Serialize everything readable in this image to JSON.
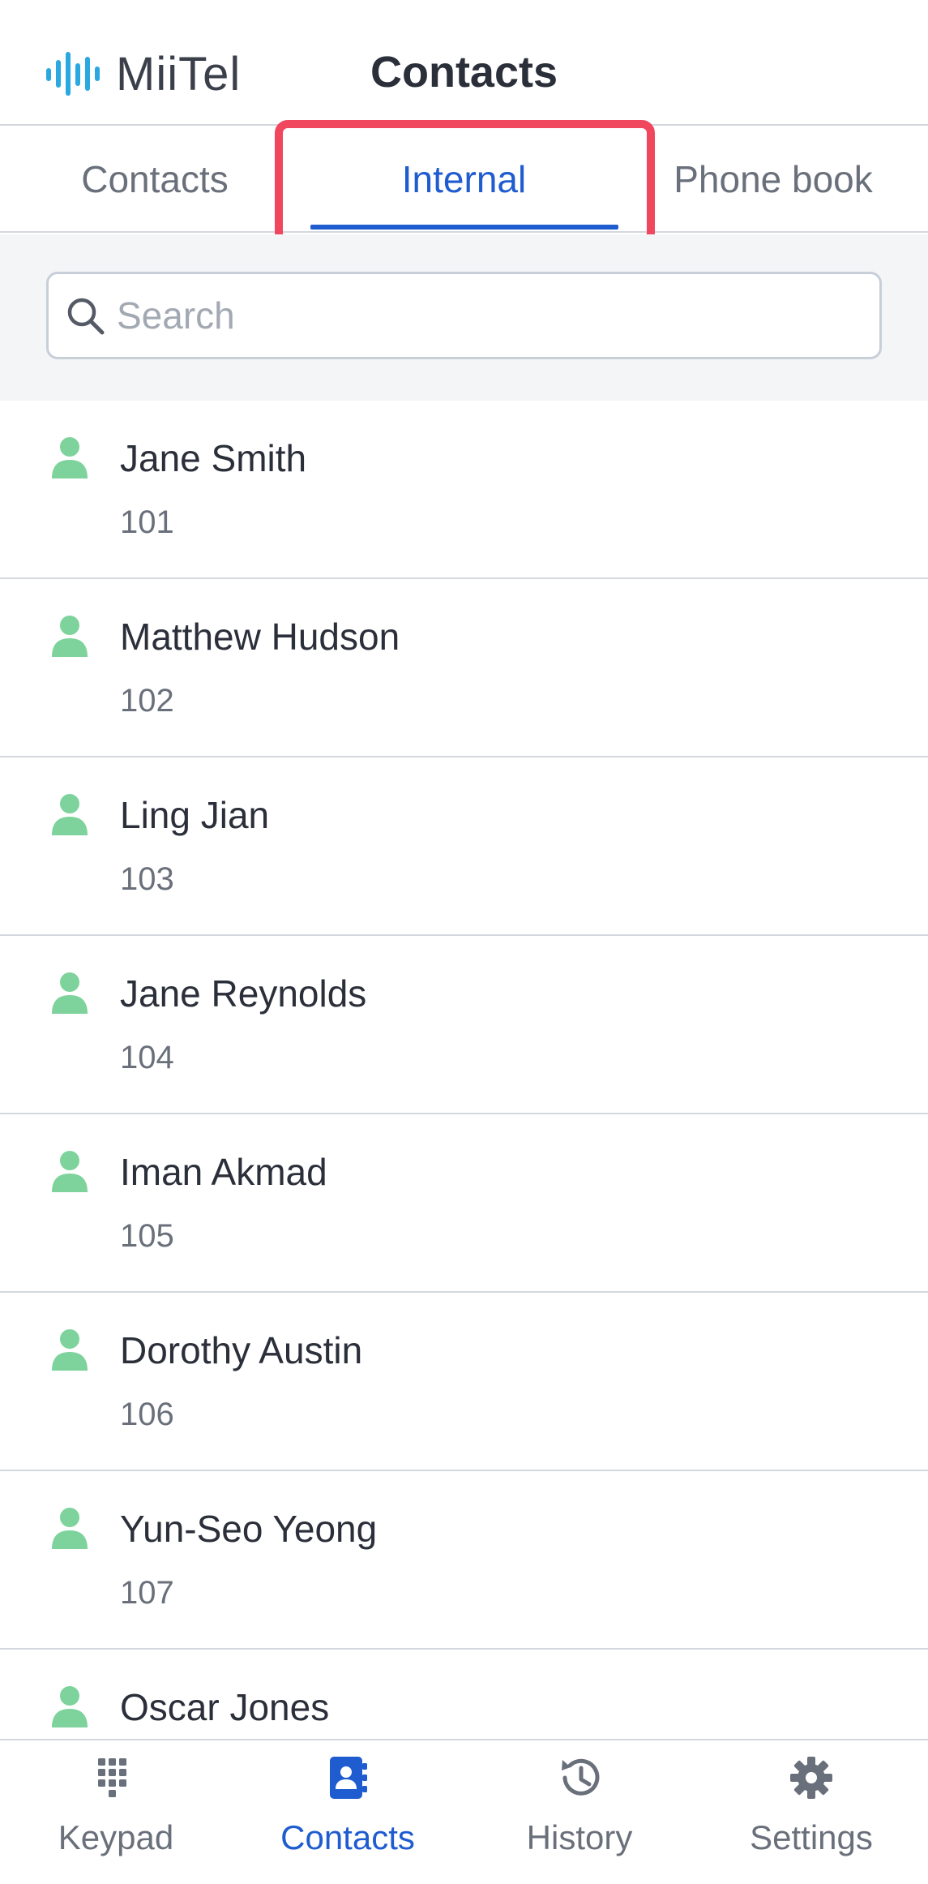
{
  "header": {
    "logo_text": "MiiTel",
    "title": "Contacts"
  },
  "tabs": [
    {
      "label": "Contacts",
      "active": false
    },
    {
      "label": "Internal",
      "active": true
    },
    {
      "label": "Phone book",
      "active": false
    }
  ],
  "search": {
    "placeholder": "Search",
    "value": ""
  },
  "contacts": [
    {
      "name": "Jane Smith",
      "ext": "101"
    },
    {
      "name": "Matthew Hudson",
      "ext": "102"
    },
    {
      "name": "Ling Jian",
      "ext": "103"
    },
    {
      "name": "Jane Reynolds",
      "ext": "104"
    },
    {
      "name": "Iman Akmad",
      "ext": "105"
    },
    {
      "name": "Dorothy Austin",
      "ext": "106"
    },
    {
      "name": "Yun-Seo Yeong",
      "ext": "107"
    },
    {
      "name": "Oscar Jones",
      "ext": ""
    }
  ],
  "bottom_nav": [
    {
      "label": "Keypad",
      "icon": "keypad-icon",
      "active": false
    },
    {
      "label": "Contacts",
      "icon": "contacts-book-icon",
      "active": true
    },
    {
      "label": "History",
      "icon": "history-icon",
      "active": false
    },
    {
      "label": "Settings",
      "icon": "gear-icon",
      "active": false
    }
  ],
  "colors": {
    "accent": "#1f5ccf",
    "avatar": "#7dd39b",
    "highlight": "#f0475f",
    "logo_bars": "#2aa8e0"
  }
}
